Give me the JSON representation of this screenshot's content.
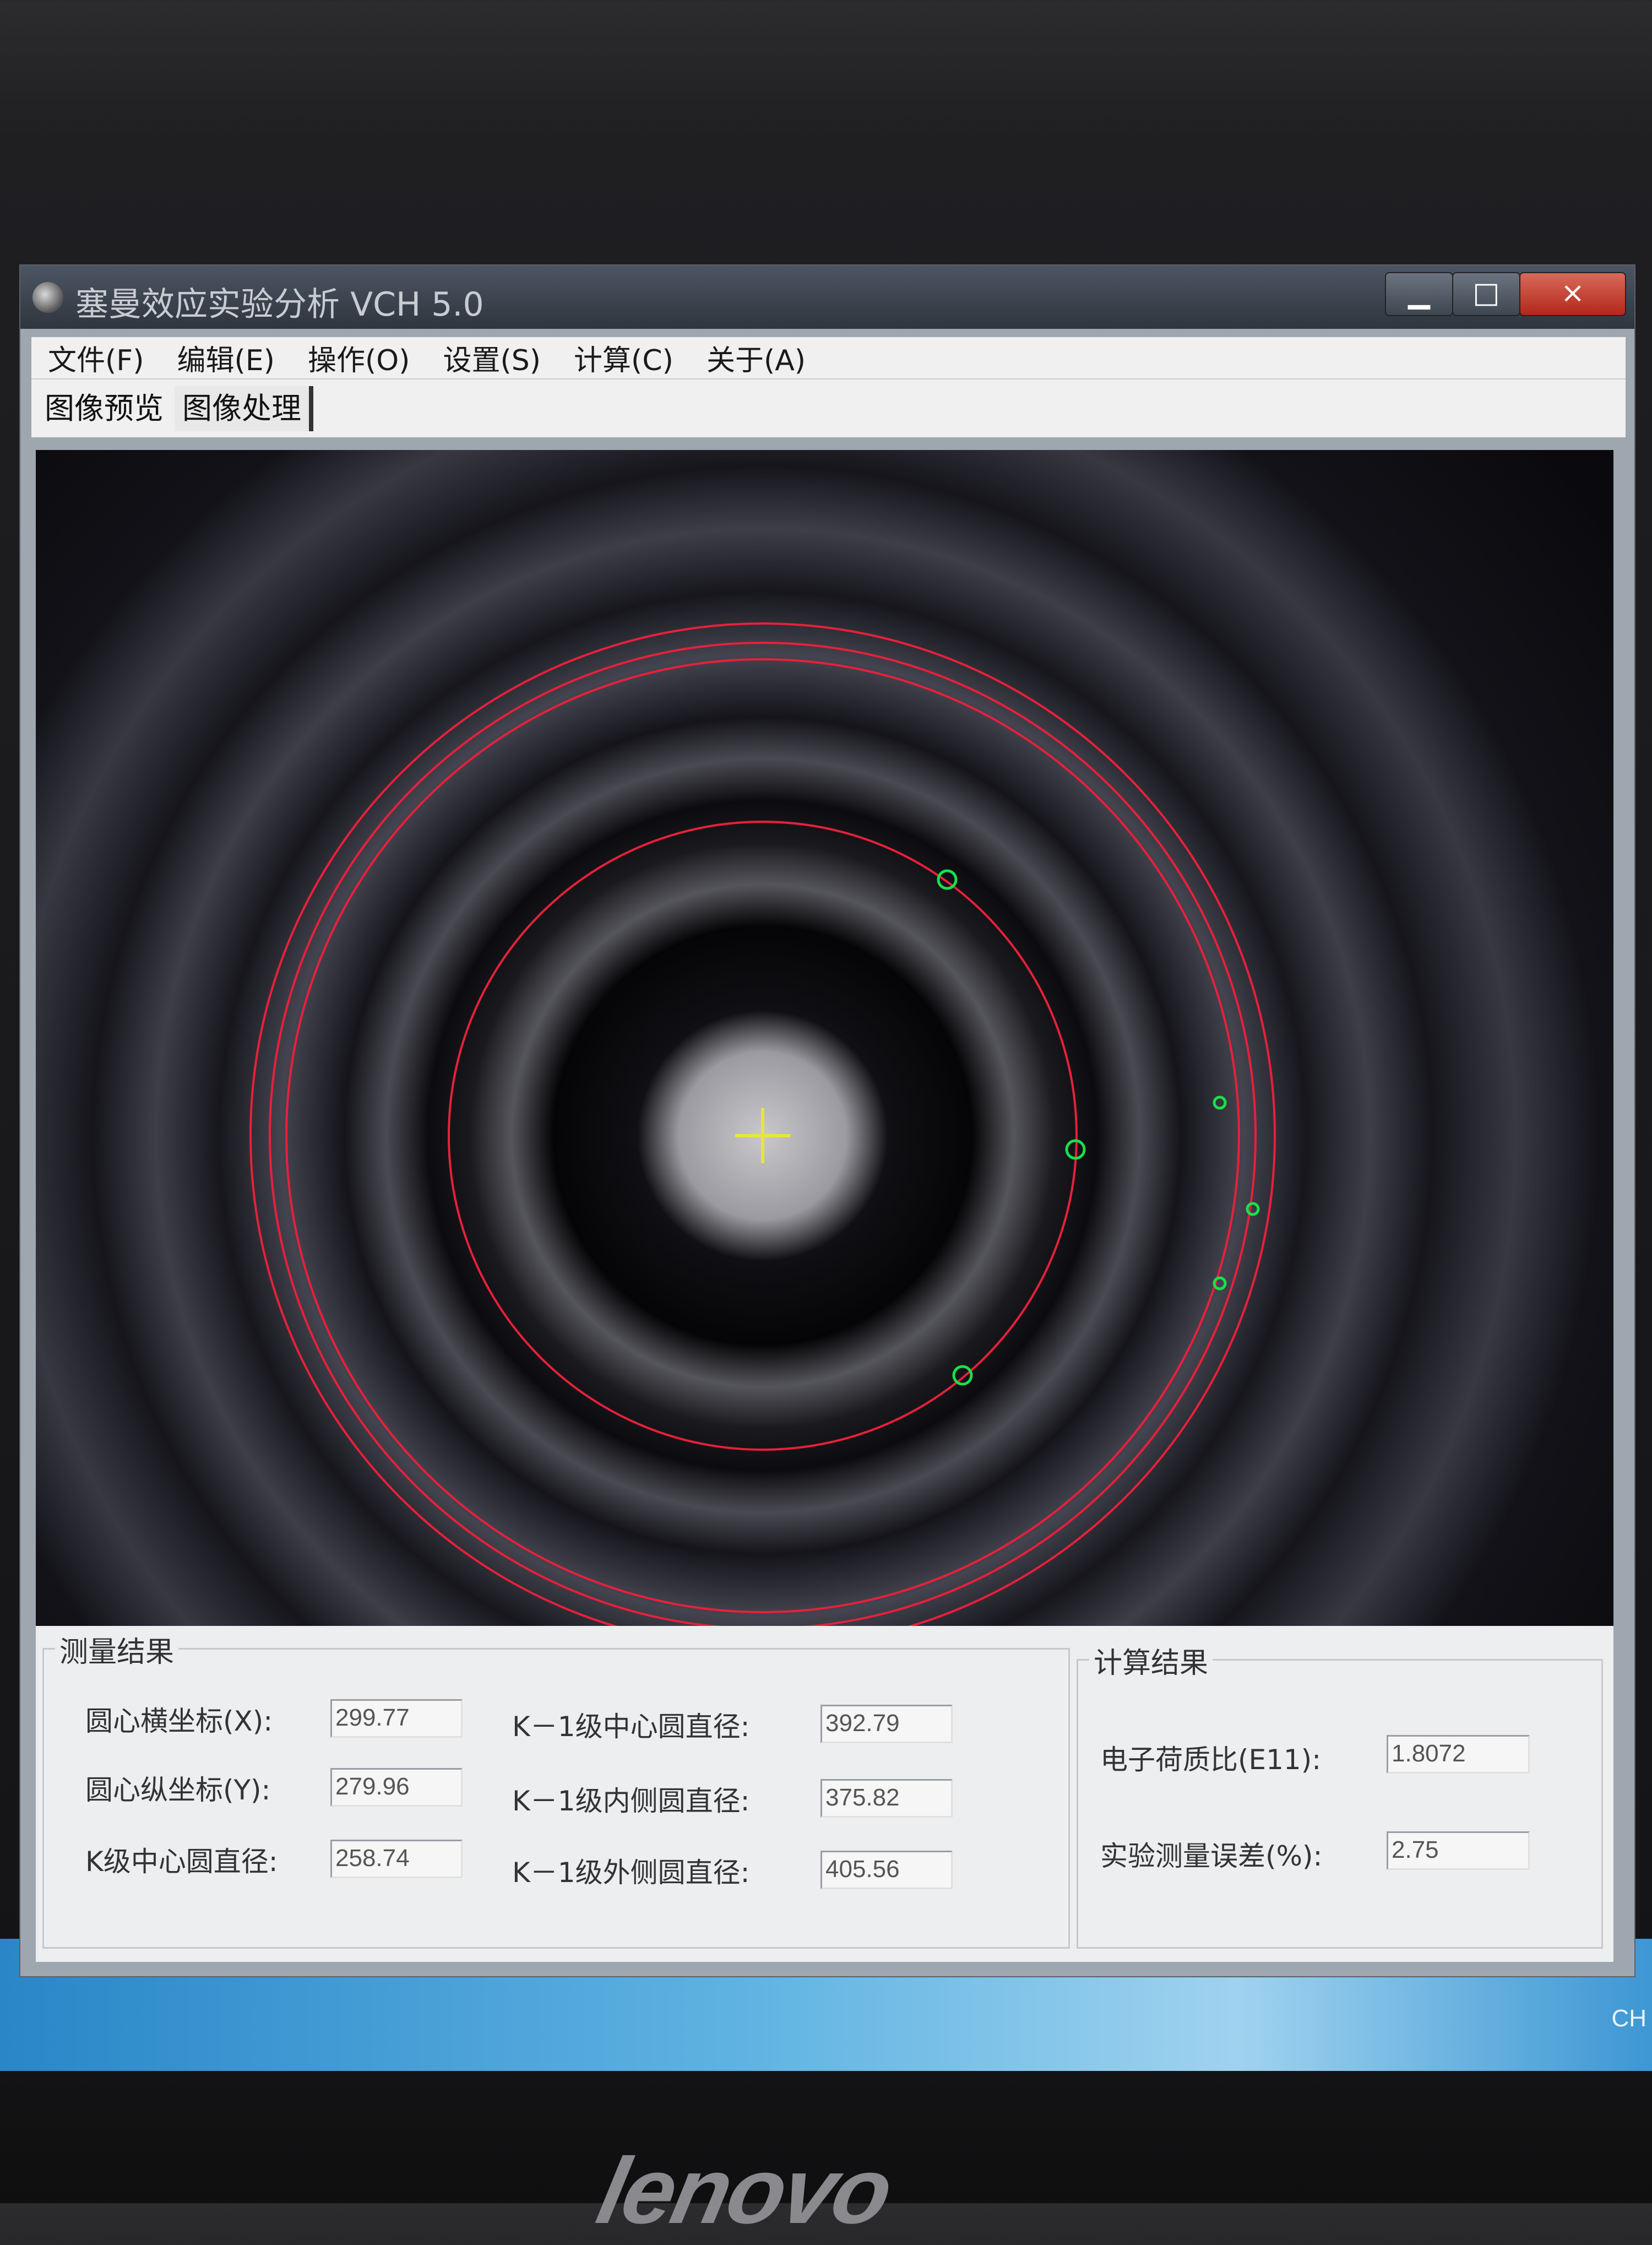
{
  "window": {
    "title": "塞曼效应实验分析 VCH 5.0",
    "close_glyph": "×",
    "min_glyph": "▁",
    "max_glyph": "□"
  },
  "menu": [
    {
      "label": "文件(F)"
    },
    {
      "label": "编辑(E)"
    },
    {
      "label": "操作(O)"
    },
    {
      "label": "设置(S)"
    },
    {
      "label": "计算(C)"
    },
    {
      "label": "关于(A)"
    }
  ],
  "tabs": {
    "preview": "图像预览",
    "process": "图像处理"
  },
  "measure": {
    "title": "测量结果",
    "x_label": "圆心横坐标(X):",
    "x_value": "299.77",
    "y_label": "圆心纵坐标(Y):",
    "y_value": "279.96",
    "k_center_label": "K级中心圆直径:",
    "k_center_value": "258.74",
    "k1_center_label": "K－1级中心圆直径:",
    "k1_center_value": "392.79",
    "k1_inner_label": "K－1级内侧圆直径:",
    "k1_inner_value": "375.82",
    "k1_outer_label": "K－1级外侧圆直径:",
    "k1_outer_value": "405.56"
  },
  "calc": {
    "title": "计算结果",
    "ratio_label": "电子荷质比(E11):",
    "ratio_value": "1.8072",
    "error_label": "实验测量误差(%):",
    "error_value": "2.75"
  },
  "taskbar": {
    "tray_text": "CH"
  },
  "bezel": {
    "logo": "lenovo"
  },
  "colors": {
    "fit_circle": "#e8203a",
    "marker": "#19e04a",
    "crosshair": "#e6e63a"
  }
}
